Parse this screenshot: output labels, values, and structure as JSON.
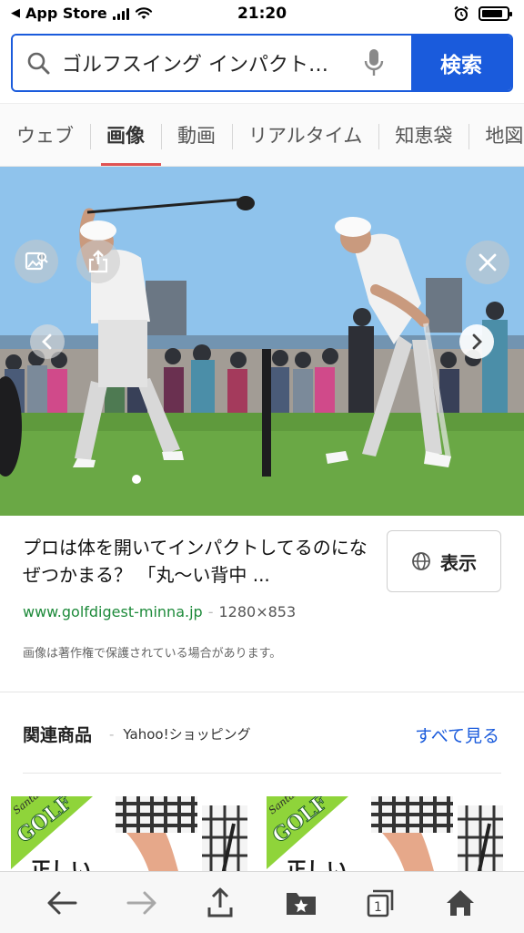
{
  "status_bar": {
    "back_app": "App Store",
    "time": "21:20",
    "battery_level": 0.85
  },
  "search": {
    "query": "ゴルフスイング インパクト…",
    "button_label": "検索"
  },
  "tabs": [
    {
      "label": "ウェブ",
      "active": false
    },
    {
      "label": "画像",
      "active": true
    },
    {
      "label": "動画",
      "active": false
    },
    {
      "label": "リアルタイム",
      "active": false
    },
    {
      "label": "知恵袋",
      "active": false
    },
    {
      "label": "地図",
      "active": false
    }
  ],
  "result": {
    "title": "プロは体を開いてインパクトしてるのになぜつかまる？ 「丸〜い背中 ...",
    "view_label": "表示",
    "domain": "www.golfdigest-minna.jp",
    "dimensions": "1280×853",
    "notice": "画像は著作権で保護されている場合があります。"
  },
  "related": {
    "title": "関連商品",
    "source": "Yahoo!ショッピング",
    "see_all": "すべて見る",
    "products": [
      {
        "brand_text": "GOLF",
        "script_text": "SantaRec",
        "tag_text": "正しい"
      },
      {
        "brand_text": "GOLF",
        "script_text": "SantaRec",
        "tag_text": "正しい"
      }
    ]
  },
  "toolbar": {
    "tabs_count": "1"
  },
  "colors": {
    "accent": "#1a5bdc",
    "active_tab_underline": "#e05353",
    "domain_green": "#1d8a3a"
  }
}
